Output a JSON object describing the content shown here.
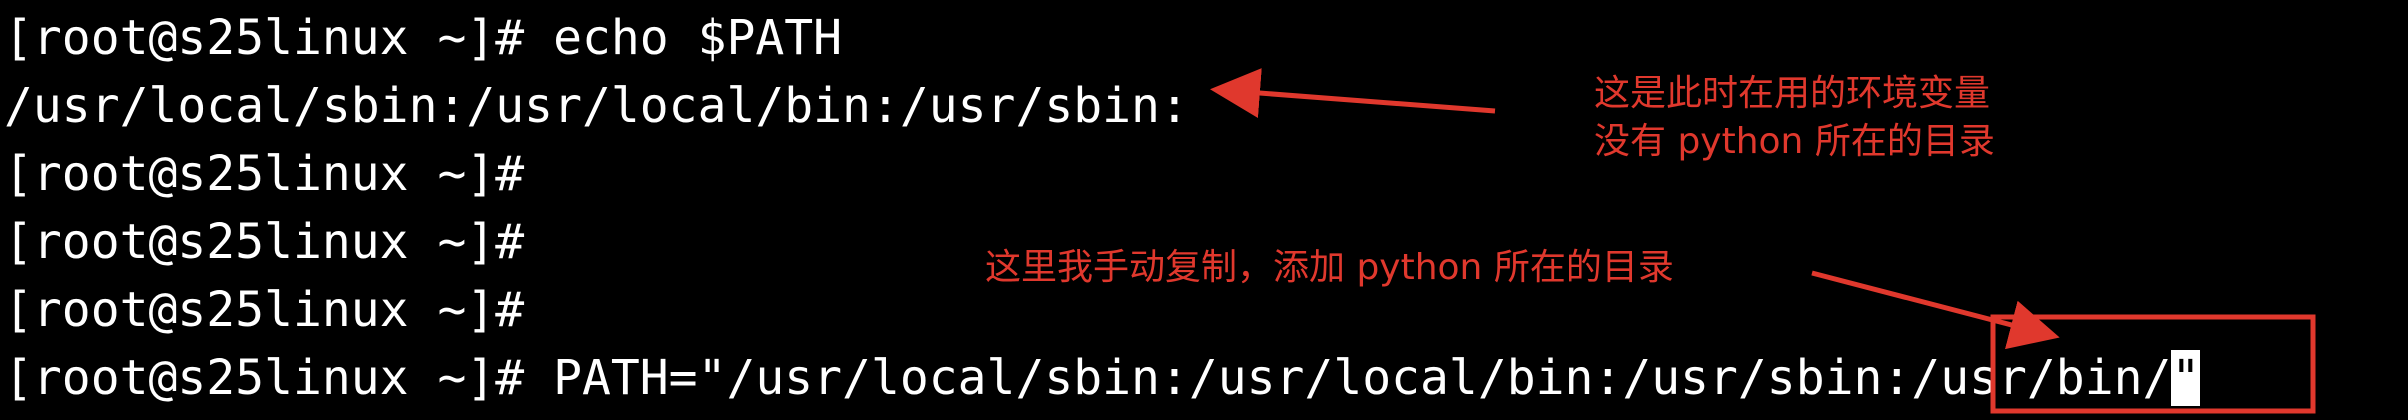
{
  "terminal": {
    "lines": [
      {
        "prompt": "[root@s25linux ~]#",
        "command": " echo $PATH"
      },
      {
        "output": "/usr/local/sbin:/usr/local/bin:/usr/sbin:"
      },
      {
        "prompt": "[root@s25linux ~]#",
        "command": ""
      },
      {
        "prompt": "[root@s25linux ~]#",
        "command": ""
      },
      {
        "prompt": "[root@s25linux ~]#",
        "command": ""
      },
      {
        "prompt": "[root@s25linux ~]#",
        "command": " PATH=\"/usr/local/sbin:/usr/local/bin:/usr/sbin:/usr/bin/",
        "cursor_char": "\""
      }
    ]
  },
  "annotations": {
    "note_top_line1": "这是此时在用的环境变量",
    "note_top_line2": "没有 python 所在的目录",
    "note_middle": "这里我手动复制，添加 python 所在的目录",
    "color": "#e0382d"
  },
  "colors": {
    "background": "#000000",
    "text": "#ffffff",
    "annotation": "#e0382d"
  }
}
